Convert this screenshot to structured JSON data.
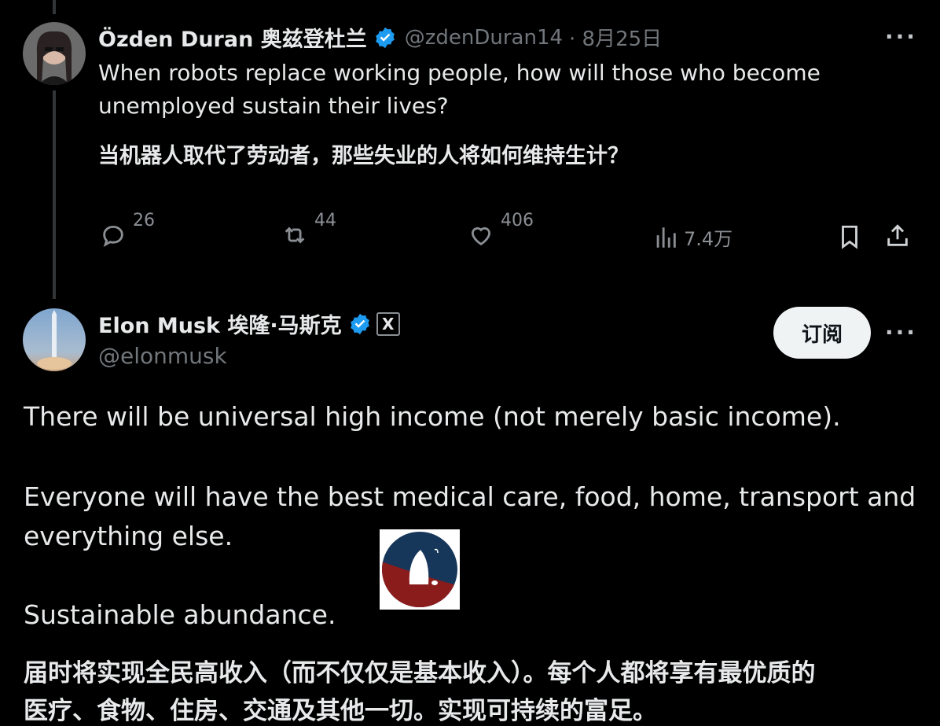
{
  "tweet1": {
    "name": "Özden Duran 奥兹登杜兰",
    "handle": "@zdenDuran14",
    "date": "· 8月25日",
    "text_en": "When robots replace working people, how will those who become unemployed sustain their lives?",
    "text_cn": "当机器人取代了劳动者，那些失业的人将如何维持生计？",
    "replies": "26",
    "reposts": "44",
    "likes": "406",
    "views": "7.4万",
    "more": "···"
  },
  "tweet2": {
    "name": "Elon Musk 埃隆·马斯克",
    "handle": "@elonmusk",
    "x_badge": "X",
    "follow_label": "订阅",
    "more": "···",
    "line1": "There will be universal high income (not merely basic income).",
    "line2": "Everyone will have the best medical care, food, home, transport and",
    "line3": "everything else.",
    "line4": "Sustainable abundance.",
    "line5_cn": "届时将实现全民高收入（而不仅仅是基本收入）。每个人都将享有最优质的",
    "line6_cn": "医疗、食物、住房、交通及其他一切。实现可持续的富足。"
  },
  "colors": {
    "background": "#000000",
    "text": "#e7e9ea",
    "muted": "#71767b",
    "verified": "#1d9bf0",
    "logo_top": "#16365a",
    "logo_bottom": "#8b1c1c"
  },
  "icons": [
    "reply-icon",
    "repost-icon",
    "like-icon",
    "views-icon",
    "bookmark-icon",
    "share-icon",
    "verified-icon",
    "more-icon"
  ]
}
